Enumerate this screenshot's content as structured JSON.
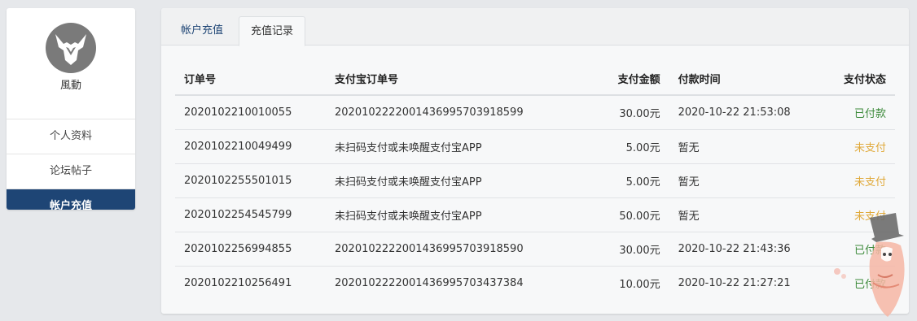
{
  "sidebar": {
    "username": "風動",
    "items": [
      {
        "label": "个人资料"
      },
      {
        "label": "论坛帖子"
      },
      {
        "label": "帐户充值"
      }
    ]
  },
  "tabs": [
    {
      "label": "帐户充值"
    },
    {
      "label": "充值记录"
    }
  ],
  "table": {
    "headers": [
      "订单号",
      "支付宝订单号",
      "支付金额",
      "付款时间",
      "支付状态"
    ],
    "rows": [
      {
        "order": "2020102210010055",
        "alipay": "2020102222001436995703918599",
        "amount": "30.00元",
        "time": "2020-10-22 21:53:08",
        "status": "已付款"
      },
      {
        "order": "2020102210049499",
        "alipay": "未扫码支付或未唤醒支付宝APP",
        "amount": "5.00元",
        "time": "暂无",
        "status": "未支付"
      },
      {
        "order": "2020102255501015",
        "alipay": "未扫码支付或未唤醒支付宝APP",
        "amount": "5.00元",
        "time": "暂无",
        "status": "未支付"
      },
      {
        "order": "2020102254545799",
        "alipay": "未扫码支付或未唤醒支付宝APP",
        "amount": "50.00元",
        "time": "暂无",
        "status": "未支付"
      },
      {
        "order": "2020102256994855",
        "alipay": "2020102222001436995703918590",
        "amount": "30.00元",
        "time": "2020-10-22 21:43:36",
        "status": "已付款"
      },
      {
        "order": "2020102210256491",
        "alipay": "2020102222001436995703437384",
        "amount": "10.00元",
        "time": "2020-10-22 21:27:21",
        "status": "已付款"
      }
    ]
  },
  "colors": {
    "accent": "#1e4575",
    "paid": "#3c8a3a",
    "unpaid": "#e0a93a"
  }
}
